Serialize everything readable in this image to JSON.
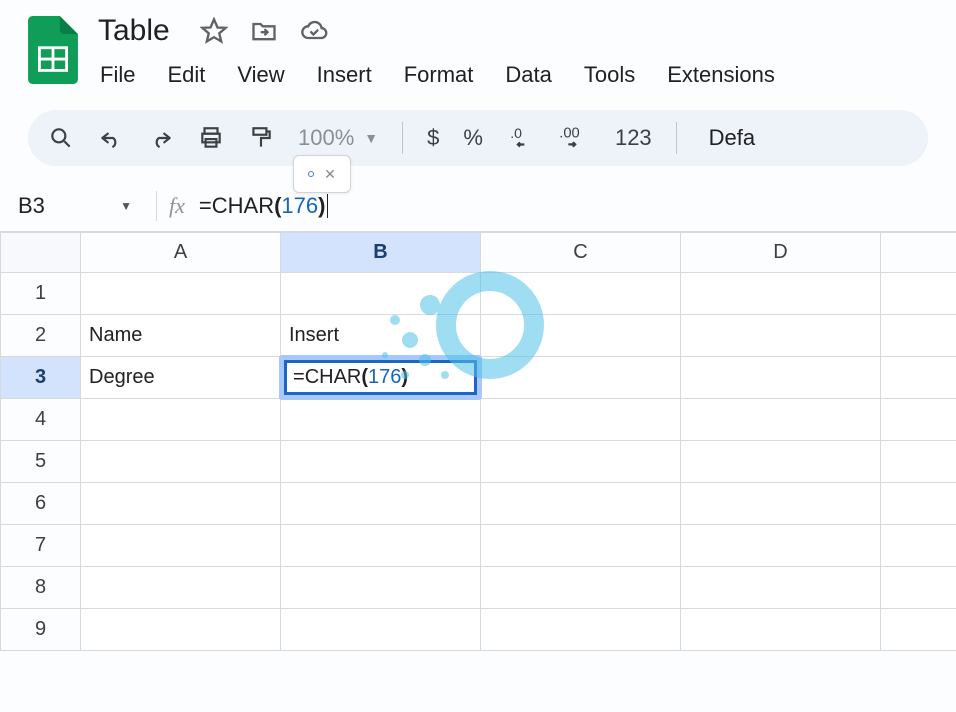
{
  "document": {
    "title": "Table"
  },
  "menu": {
    "file": "File",
    "edit": "Edit",
    "view": "View",
    "insert": "Insert",
    "format": "Format",
    "data": "Data",
    "tools": "Tools",
    "extensions": "Extensions"
  },
  "toolbar": {
    "zoom": "100%",
    "currency": "$",
    "percent": "%",
    "dec_dec": ".0",
    "inc_dec": ".00",
    "number_fmt": "123",
    "font": "Defa"
  },
  "formula_bar": {
    "cell_ref": "B3",
    "fx_label": "fx",
    "formula": {
      "eq": "=",
      "fn": "CHAR",
      "open": "(",
      "arg": "176",
      "close": ")"
    }
  },
  "sheet": {
    "columns": [
      "A",
      "B",
      "C",
      "D",
      ""
    ],
    "rows": [
      "1",
      "2",
      "3",
      "4",
      "5",
      "6",
      "7",
      "8",
      "9"
    ],
    "cells": {
      "A2": "Name",
      "B2": "Insert",
      "A3": "Degree"
    },
    "selected_col": "B",
    "selected_row": "3"
  }
}
